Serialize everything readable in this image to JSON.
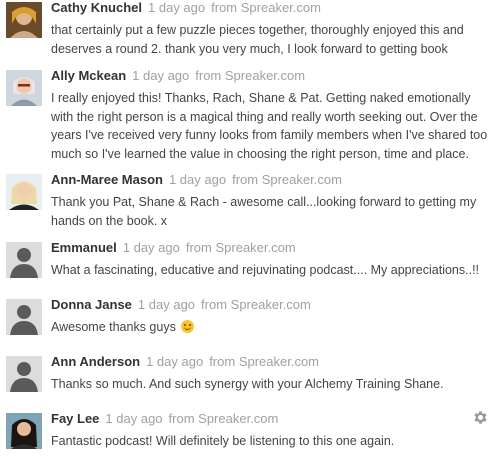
{
  "comments": [
    {
      "author": "Cathy Knuchel",
      "time": "1 day ago",
      "from_label": "from",
      "source": "Spreaker.com",
      "text": "that certainly put a few puzzle pieces together, thoroughly enjoyed this and deserves a round 2. thank you very much, I look forward to getting book",
      "avatar": "photo"
    },
    {
      "author": "Ally Mckean",
      "time": "1 day ago",
      "from_label": "from",
      "source": "Spreaker.com",
      "text": "I really enjoyed this! Thanks, Rach, Shane & Pat. Getting naked emotionally with the right person is a magical thing and really worth seeking out. Over the years I've received very funny looks from family members when I've shared too much so I've learned the value in choosing the right person, time and place.",
      "avatar": "photo"
    },
    {
      "author": "Ann-Maree Mason",
      "time": "1 day ago",
      "from_label": "from",
      "source": "Spreaker.com",
      "text": "Thank you Pat, Shane & Rach - awesome call...looking forward to getting my hands on the book. x",
      "avatar": "photo"
    },
    {
      "author": "Emmanuel",
      "time": "1 day ago",
      "from_label": "from",
      "source": "Spreaker.com",
      "text": "What a fascinating, educative and rejuvinating podcast.... My appreciations..!!",
      "avatar": "default"
    },
    {
      "author": "Donna Janse",
      "time": "1 day ago",
      "from_label": "from",
      "source": "Spreaker.com",
      "text": "Awesome thanks guys",
      "avatar": "default"
    },
    {
      "author": "Ann Anderson",
      "time": "1 day ago",
      "from_label": "from",
      "source": "Spreaker.com",
      "text": "Thanks so much. And such synergy with your Alchemy Training Shane.",
      "avatar": "default"
    },
    {
      "author": "Fay Lee",
      "time": "1 day ago",
      "from_label": "from",
      "source": "Spreaker.com",
      "text": "Fantastic podcast! Will definitely be listening to this one again.",
      "avatar": "photo"
    }
  ],
  "icons": {
    "settings": "gear-icon",
    "emoji": "smiley-emoji"
  },
  "colors": {
    "meta_grey": "#a0a0a0",
    "emoji_yellow": "#f6c431"
  }
}
